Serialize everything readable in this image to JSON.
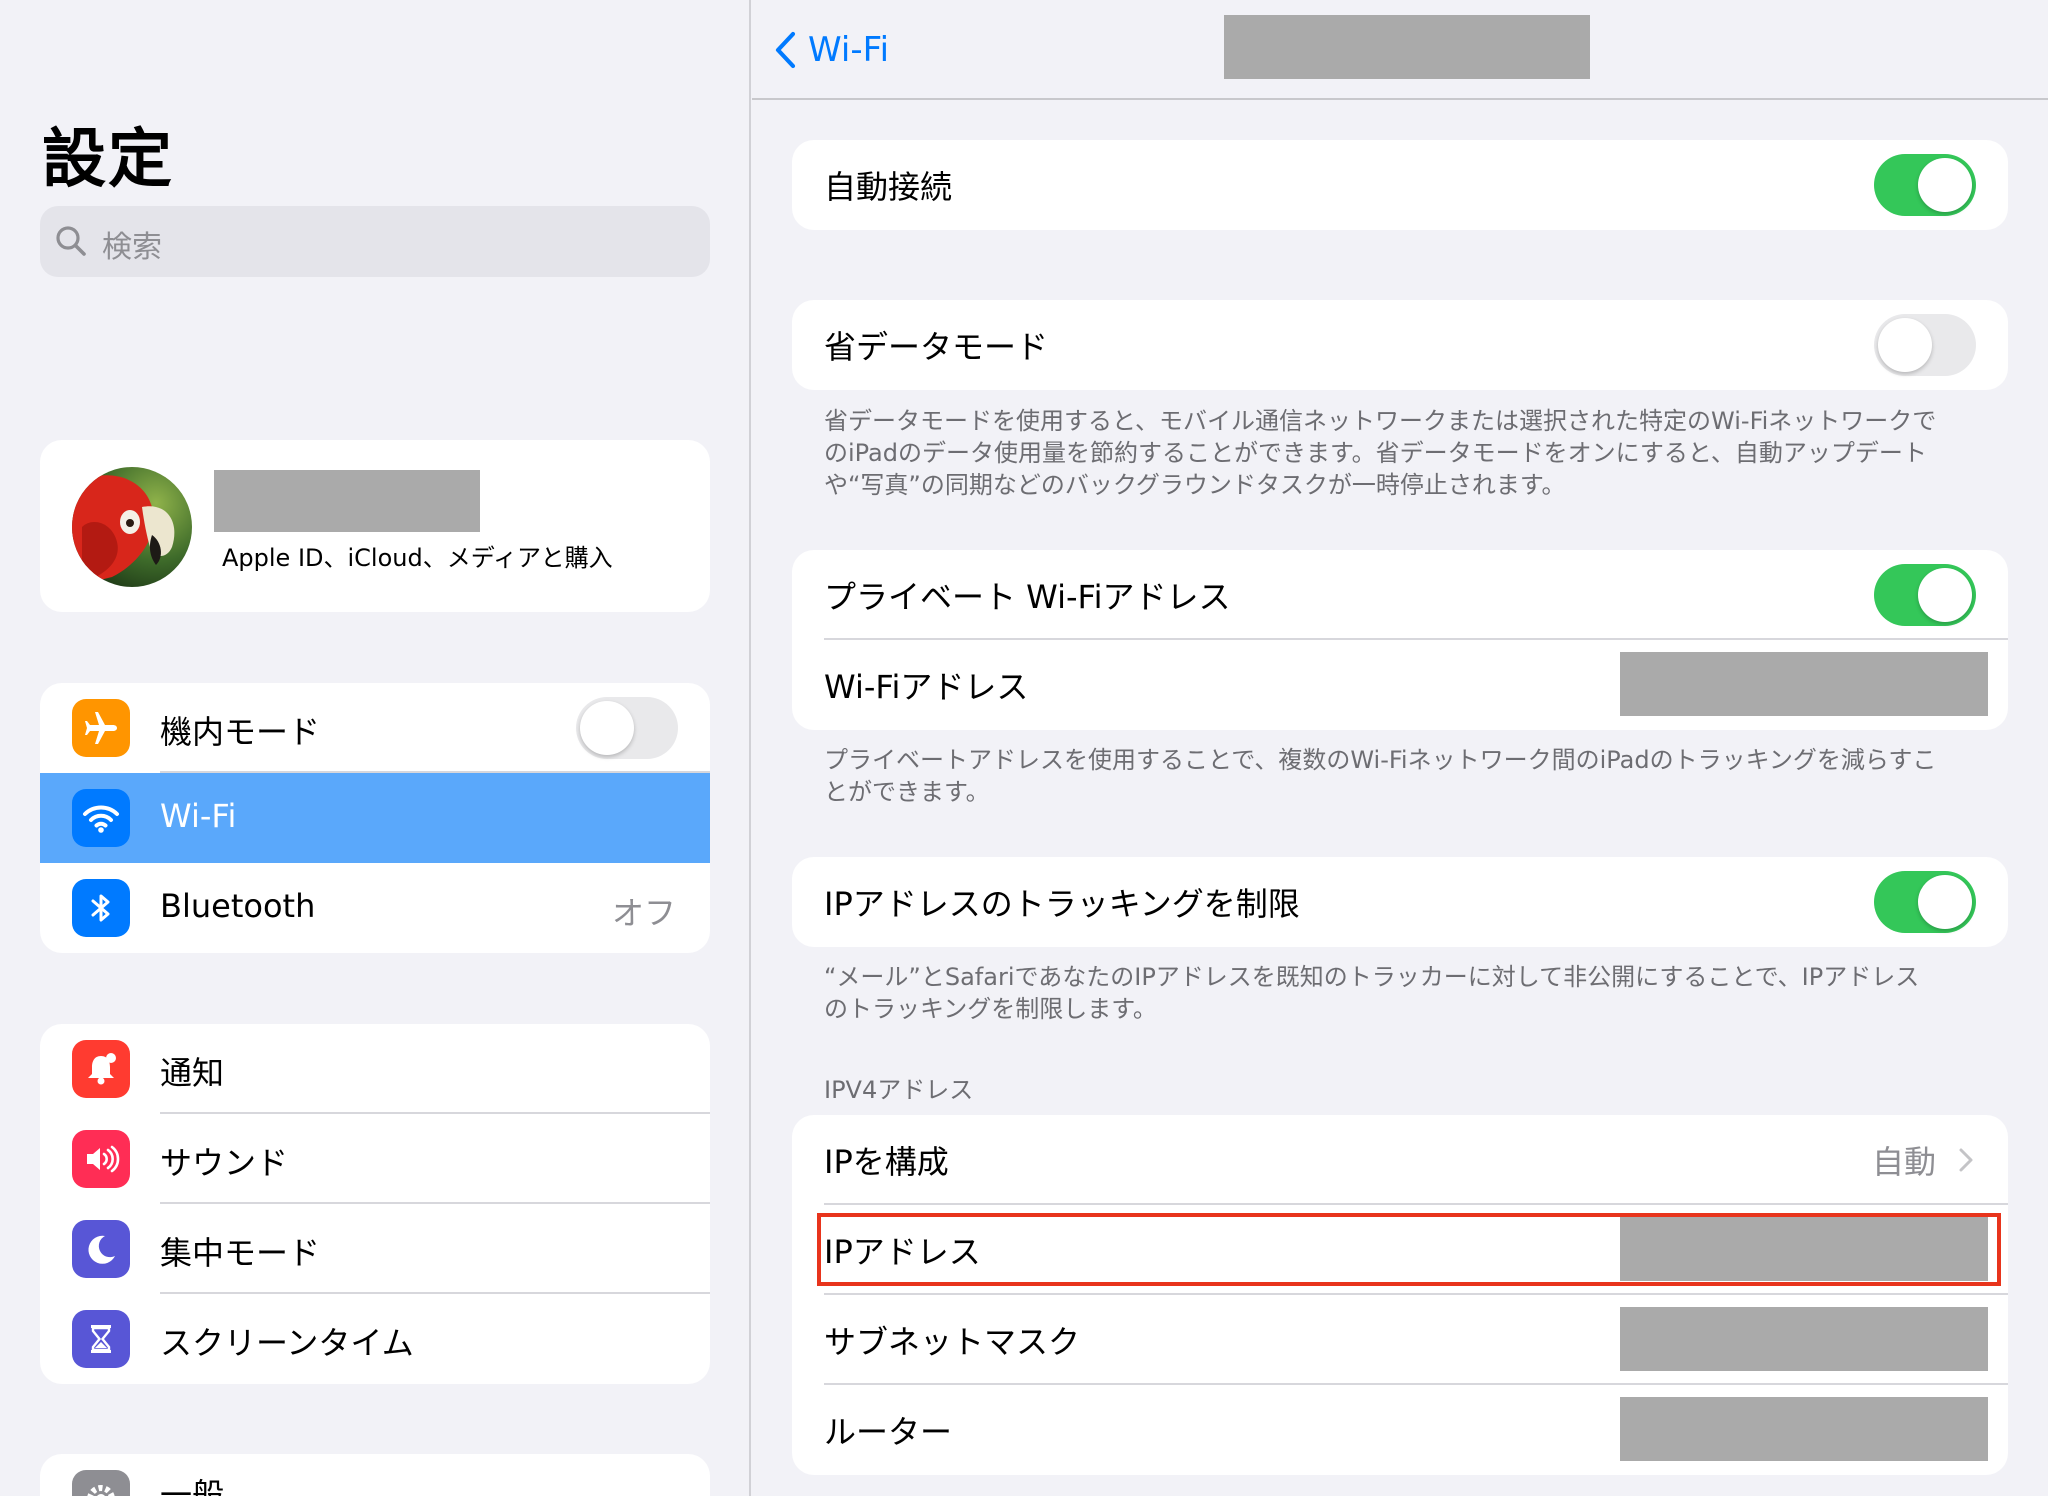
{
  "sidebar": {
    "title": "設定",
    "search_placeholder": "検索",
    "profile_subtitle": "Apple ID、iCloud、メディアと購入",
    "group1": [
      {
        "label": "機内モード",
        "icon": "airplane-icon",
        "color": "#ff9500",
        "toggle": false
      },
      {
        "label": "Wi-Fi",
        "icon": "wifi-icon",
        "color": "#007aff",
        "selected": true
      },
      {
        "label": "Bluetooth",
        "icon": "bluetooth-icon",
        "color": "#007aff",
        "value": "オフ"
      }
    ],
    "group2": [
      {
        "label": "通知",
        "icon": "notification-bell-icon",
        "color": "#ff3b30"
      },
      {
        "label": "サウンド",
        "icon": "speaker-icon",
        "color": "#ff2d55"
      },
      {
        "label": "集中モード",
        "icon": "moon-icon",
        "color": "#5856d6"
      },
      {
        "label": "スクリーンタイム",
        "icon": "hourglass-icon",
        "color": "#5856d6"
      }
    ],
    "group3_partial": {
      "label": "一般",
      "icon": "gear-icon",
      "color": "#8e8e93"
    }
  },
  "detail": {
    "back_label": "Wi-Fi",
    "auto_join": {
      "label": "自動接続",
      "toggle": true
    },
    "low_data": {
      "label": "省データモード",
      "toggle": false,
      "footnote_lines": [
        "省データモードを使用すると、モバイル通信ネットワークまたは選択された特定のWi-Fiネットワークで",
        "のiPadのデータ使用量を節約することができます。省データモードをオンにすると、自動アップデート",
        "や“写真”の同期などのバックグラウンドタスクが一時停止されます。"
      ]
    },
    "private_address": {
      "label": "プライベート Wi-Fiアドレス",
      "toggle": true,
      "wifi_address_label": "Wi-Fiアドレス",
      "footnote_lines": [
        "プライベートアドレスを使用することで、複数のWi-Fiネットワーク間のiPadのトラッキングを減らすこ",
        "とができます。"
      ]
    },
    "limit_tracking": {
      "label": "IPアドレスのトラッキングを制限",
      "toggle": true,
      "footnote_lines": [
        "“メール”とSafariであなたのIPアドレスを既知のトラッカーに対して非公開にすることで、IPアドレス",
        "のトラッキングを制限します。"
      ]
    },
    "ipv4": {
      "header": "IPV4アドレス",
      "configure_label": "IPを構成",
      "configure_value": "自動",
      "ip_address_label": "IPアドレス",
      "subnet_label": "サブネットマスク",
      "router_label": "ルーター"
    }
  }
}
